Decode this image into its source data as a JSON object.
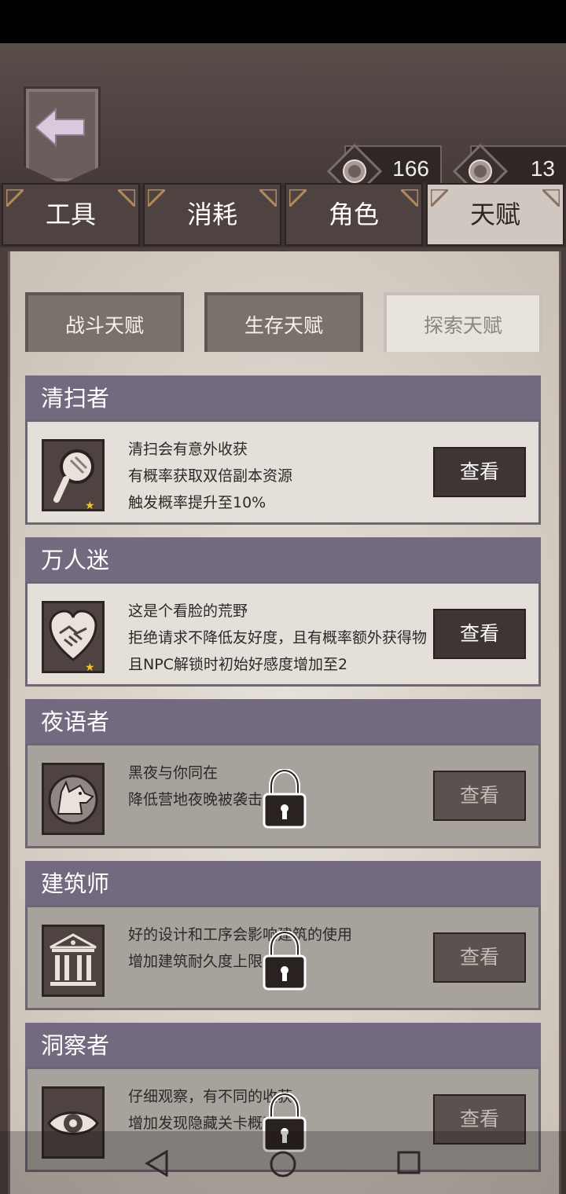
{
  "header": {
    "back_label": "返回",
    "currencies": [
      {
        "icon": "coin-icon",
        "value": "166"
      },
      {
        "icon": "gem-icon",
        "value": "13"
      }
    ]
  },
  "tabs": [
    {
      "label": "工具",
      "active": false
    },
    {
      "label": "消耗",
      "active": false
    },
    {
      "label": "角色",
      "active": false
    },
    {
      "label": "天赋",
      "active": true
    }
  ],
  "subtabs": [
    {
      "label": "战斗天赋",
      "active": false
    },
    {
      "label": "生存天赋",
      "active": false
    },
    {
      "label": "探索天赋",
      "active": true
    }
  ],
  "talents": [
    {
      "title": "清扫者",
      "icon": "magnifier-icon",
      "star": "★",
      "lines": [
        "清扫会有意外收获",
        "有概率获取双倍副本资源",
        "触发概率提升至10%"
      ],
      "button": "查看",
      "locked": false
    },
    {
      "title": "万人迷",
      "icon": "heart-handshake-icon",
      "star": "★",
      "lines": [
        "这是个看脸的荒野",
        "拒绝请求不降低友好度，且有概率额外获得物",
        "且NPC解锁时初始好感度增加至2"
      ],
      "button": "查看",
      "locked": false
    },
    {
      "title": "夜语者",
      "icon": "wolf-icon",
      "lines": [
        "黑夜与你同在",
        "降低营地夜晚被袭击"
      ],
      "button": "查看",
      "locked": true
    },
    {
      "title": "建筑师",
      "icon": "building-icon",
      "lines": [
        "好的设计和工序会影响建筑的使用",
        "增加建筑耐久度上限"
      ],
      "button": "查看",
      "locked": true
    },
    {
      "title": "洞察者",
      "icon": "eye-icon",
      "lines": [
        "仔细观察，有不同的收获",
        "增加发现隐藏关卡概率"
      ],
      "button": "查看",
      "locked": true
    }
  ],
  "colors": {
    "title_bar": "#736a7f",
    "button": "#3f3534",
    "parchment": "#e4dfd8",
    "star": "#f1c232"
  }
}
